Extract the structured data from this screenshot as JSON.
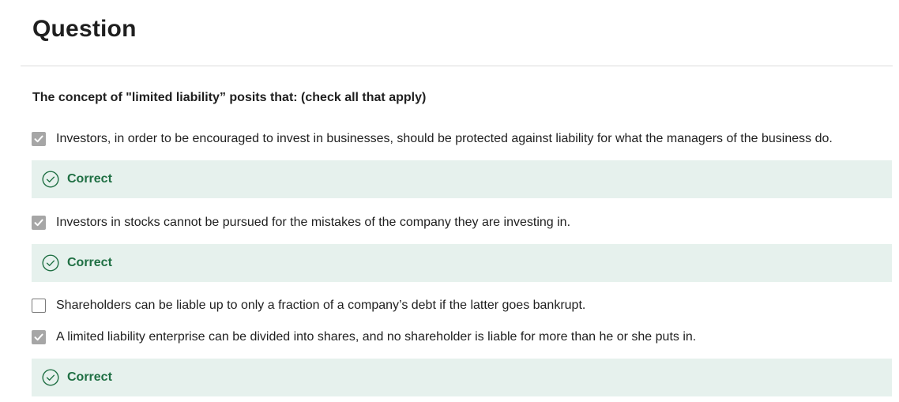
{
  "header": {
    "title": "Question"
  },
  "question": {
    "prompt": "The concept of \"limited liability” posits that: (check all that apply)",
    "options": [
      {
        "text": "Investors, in order to be encouraged to invest in businesses, should be protected against liability for what the managers of the business do.",
        "checked": true,
        "feedback": "Correct"
      },
      {
        "text": "Investors in stocks cannot be pursued for the mistakes of the company they are investing in.",
        "checked": true,
        "feedback": "Correct"
      },
      {
        "text": "Shareholders can be liable up to only a fraction of a company’s debt if the latter goes bankrupt.",
        "checked": false,
        "feedback": ""
      },
      {
        "text": "A limited liability enterprise can be divided into shares, and no shareholder is liable for more than he or she puts in.",
        "checked": true,
        "feedback": "Correct"
      }
    ]
  },
  "colors": {
    "correct_text": "#1f6f43",
    "correct_background": "#e6f1ed",
    "checkbox_checked": "#a6a6a6"
  },
  "icons": {
    "checked": "checkmark-icon",
    "correct": "check-circle-icon"
  }
}
